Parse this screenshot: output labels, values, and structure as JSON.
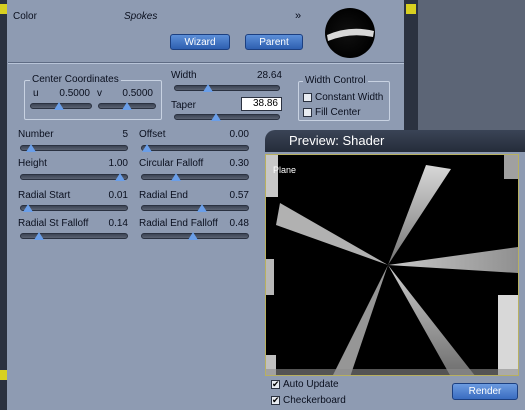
{
  "header": {
    "channel_label": "Color",
    "texture_name": "Spokes",
    "chevron": "»",
    "wizard_label": "Wizard",
    "parent_label": "Parent"
  },
  "center": {
    "title": "Center Coordinates",
    "u_label": "u",
    "u_value": "0.5000",
    "v_label": "v",
    "v_value": "0.5000",
    "u_level": 0.45,
    "v_level": 0.5
  },
  "width": {
    "label": "Width",
    "value": "28.64",
    "level": 0.3
  },
  "taper": {
    "label": "Taper",
    "value": "38.86",
    "level": 0.38
  },
  "width_control": {
    "title": "Width Control",
    "constant_label": "Constant Width",
    "constant_checked": false,
    "fill_label": "Fill Center",
    "fill_checked": false
  },
  "params_left": [
    {
      "label": "Number",
      "value": "5",
      "level": 0.05
    },
    {
      "label": "Height",
      "value": "1.00",
      "level": 0.98
    },
    {
      "label": "Radial Start",
      "value": "0.01",
      "level": 0.02
    },
    {
      "label": "Radial St Falloff",
      "value": "0.14",
      "level": 0.14
    }
  ],
  "params_right": [
    {
      "label": "Offset",
      "value": "0.00",
      "level": 0.0
    },
    {
      "label": "Circular Falloff",
      "value": "0.30",
      "level": 0.3
    },
    {
      "label": "Radial End",
      "value": "0.57",
      "level": 0.57
    },
    {
      "label": "Radial End Falloff",
      "value": "0.48",
      "level": 0.48
    }
  ],
  "preview": {
    "title": "Preview: Shader",
    "object_label": "Plane",
    "auto_update_label": "Auto Update",
    "auto_update_checked": true,
    "checkerboard_label": "Checkerboard",
    "checkerboard_checked": true,
    "render_label": "Render"
  },
  "colors": {
    "panel_bg": "#8e9bb2",
    "button_blue": "#3a6cc0",
    "title_bar": "#252c3a",
    "cap_yellow": "#d8d020"
  }
}
